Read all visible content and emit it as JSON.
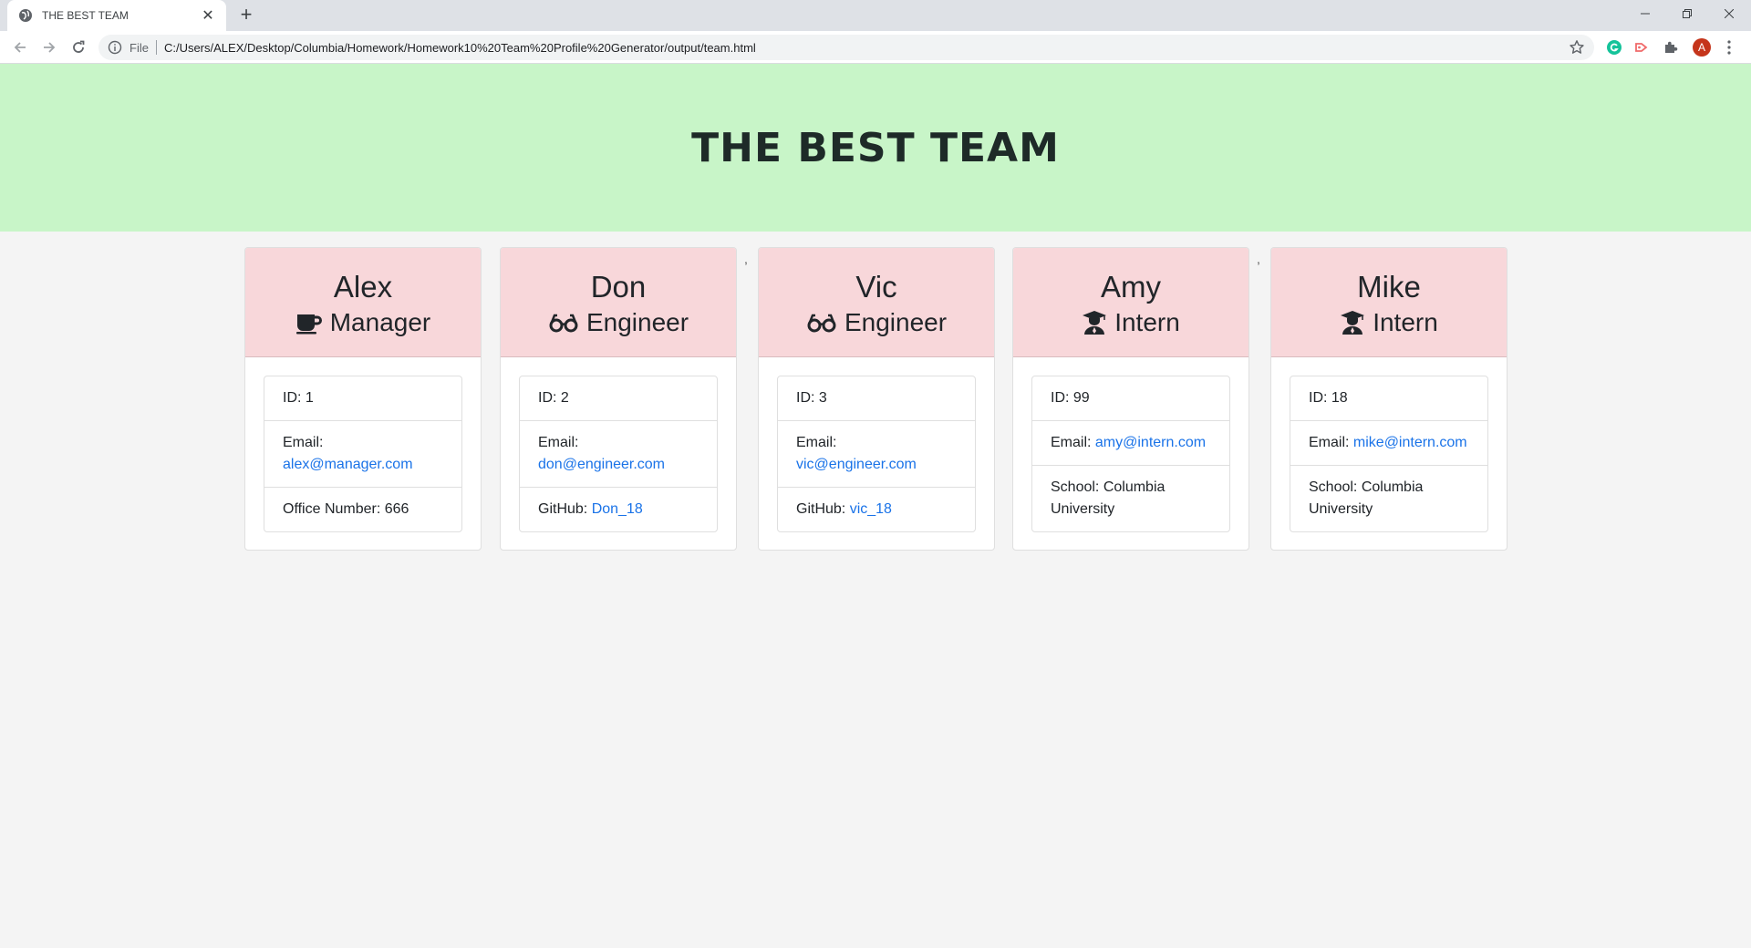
{
  "browser": {
    "tab_title": "THE BEST TEAM",
    "url_scheme": "File",
    "url": "C:/Users/ALEX/Desktop/Columbia/Homework/Homework10%20Team%20Profile%20Generator/output/team.html",
    "profile_initial": "A"
  },
  "page": {
    "title": "THE BEST TEAM",
    "stray_commas": [
      ",",
      ","
    ]
  },
  "employees": [
    {
      "name": "Alex",
      "role": "Manager",
      "role_icon": "coffee-icon",
      "id": "ID: 1",
      "email_label": "Email:",
      "email": "alex@manager.com",
      "extra_label": "Office Number: 666",
      "extra_value": ""
    },
    {
      "name": "Don",
      "role": "Engineer",
      "role_icon": "glasses-icon",
      "id": "ID: 2",
      "email_label": "Email:",
      "email": "don@engineer.com",
      "extra_label": "GitHub:",
      "extra_value": "Don_18"
    },
    {
      "name": "Vic",
      "role": "Engineer",
      "role_icon": "glasses-icon",
      "id": "ID: 3",
      "email_label": "Email:",
      "email": "vic@engineer.com",
      "extra_label": "GitHub:",
      "extra_value": "vic_18"
    },
    {
      "name": "Amy",
      "role": "Intern",
      "role_icon": "graduate-icon",
      "id": "ID: 99",
      "email_label": "Email:",
      "email": "amy@intern.com",
      "extra_label": "School: Columbia University",
      "extra_value": ""
    },
    {
      "name": "Mike",
      "role": "Intern",
      "role_icon": "graduate-icon",
      "id": "ID: 18",
      "email_label": "Email:",
      "email": "mike@intern.com",
      "extra_label": "School: Columbia University",
      "extra_value": ""
    }
  ],
  "colors": {
    "header_bg": "#c8f5c8",
    "card_header_bg": "#f8d7da",
    "page_bg": "#f4f4f4",
    "link": "#1a73e8"
  }
}
